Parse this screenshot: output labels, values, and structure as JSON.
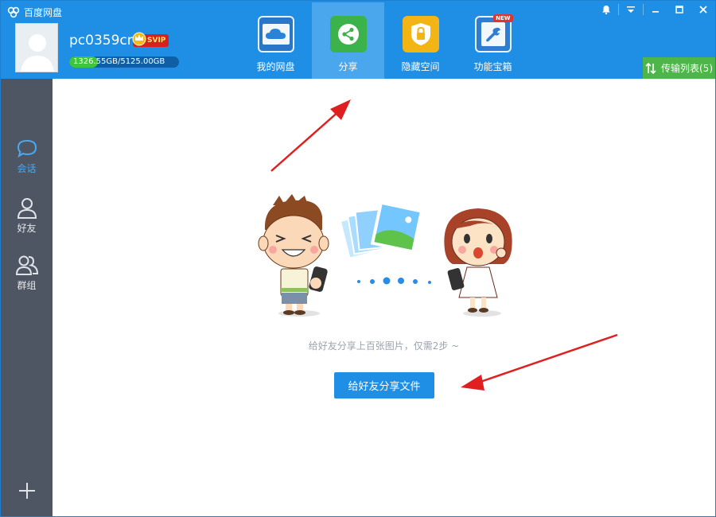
{
  "window": {
    "title": "百度网盘"
  },
  "user": {
    "name": "pc0359cn",
    "vip_label": "SVIP",
    "storage_used": "1326.55GB",
    "storage_total": "5125.00GB",
    "storage_text": "1326.55GB/5125.00GB",
    "storage_fraction": 0.259
  },
  "nav": {
    "items": [
      {
        "label": "我的网盘",
        "icon": "cloud-icon"
      },
      {
        "label": "分享",
        "icon": "share-icon",
        "active": true
      },
      {
        "label": "隐藏空间",
        "icon": "lock-icon"
      },
      {
        "label": "功能宝箱",
        "icon": "wrench-icon",
        "badge": "NEW"
      }
    ]
  },
  "transfer": {
    "label": "传输列表(5)"
  },
  "sidebar": {
    "items": [
      {
        "label": "会话",
        "icon": "chat-bubble-icon",
        "active": true
      },
      {
        "label": "好友",
        "icon": "person-icon"
      },
      {
        "label": "群组",
        "icon": "group-icon"
      }
    ],
    "add_icon": "plus-icon"
  },
  "main": {
    "hint": "给好友分享上百张图片，仅需2步 ~",
    "share_button": "给好友分享文件"
  },
  "colors": {
    "header": "#1e8fe5",
    "nav_active": "#4aa7ee",
    "sidebar": "#4e5563",
    "transfer": "#4eb54a",
    "button": "#1e8fe5",
    "arrow": "#e02020"
  }
}
